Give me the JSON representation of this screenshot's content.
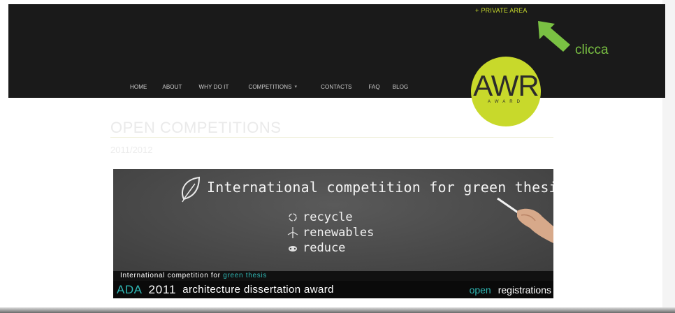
{
  "header": {
    "private_area": {
      "plus": "+",
      "label": "PRIVATE AREA"
    },
    "annotation": {
      "text": "clicca",
      "color": "#7ac143"
    },
    "nav": {
      "home": "HOME",
      "about": "ABOUT",
      "why": "WHY DO IT",
      "competitions": "COMPETITIONS",
      "competitions_caret": "▾",
      "contacts": "CONTACTS",
      "faq": "FAQ",
      "blog": "BLOG"
    },
    "logo": {
      "main": "AWR",
      "sub": "AWARD",
      "color": "#c8d92b"
    }
  },
  "main": {
    "title": "OPEN COMPETITIONS",
    "subheading": "2011/2012"
  },
  "banner": {
    "headline": "International competition for green thesis",
    "items": [
      {
        "icon": "recycle-icon",
        "label": "recycle"
      },
      {
        "icon": "wind-turbine-icon",
        "label": "renewables"
      },
      {
        "icon": "reduce-icon",
        "label": "reduce"
      }
    ],
    "strip_text_prefix": "International competition for ",
    "strip_text_accent": "green thesis",
    "acronym": "ADA",
    "year": "2011",
    "name": "architecture dissertation award",
    "open_word": "open",
    "registrations_word": "registrations",
    "accent_color": "#2fb8b5"
  }
}
